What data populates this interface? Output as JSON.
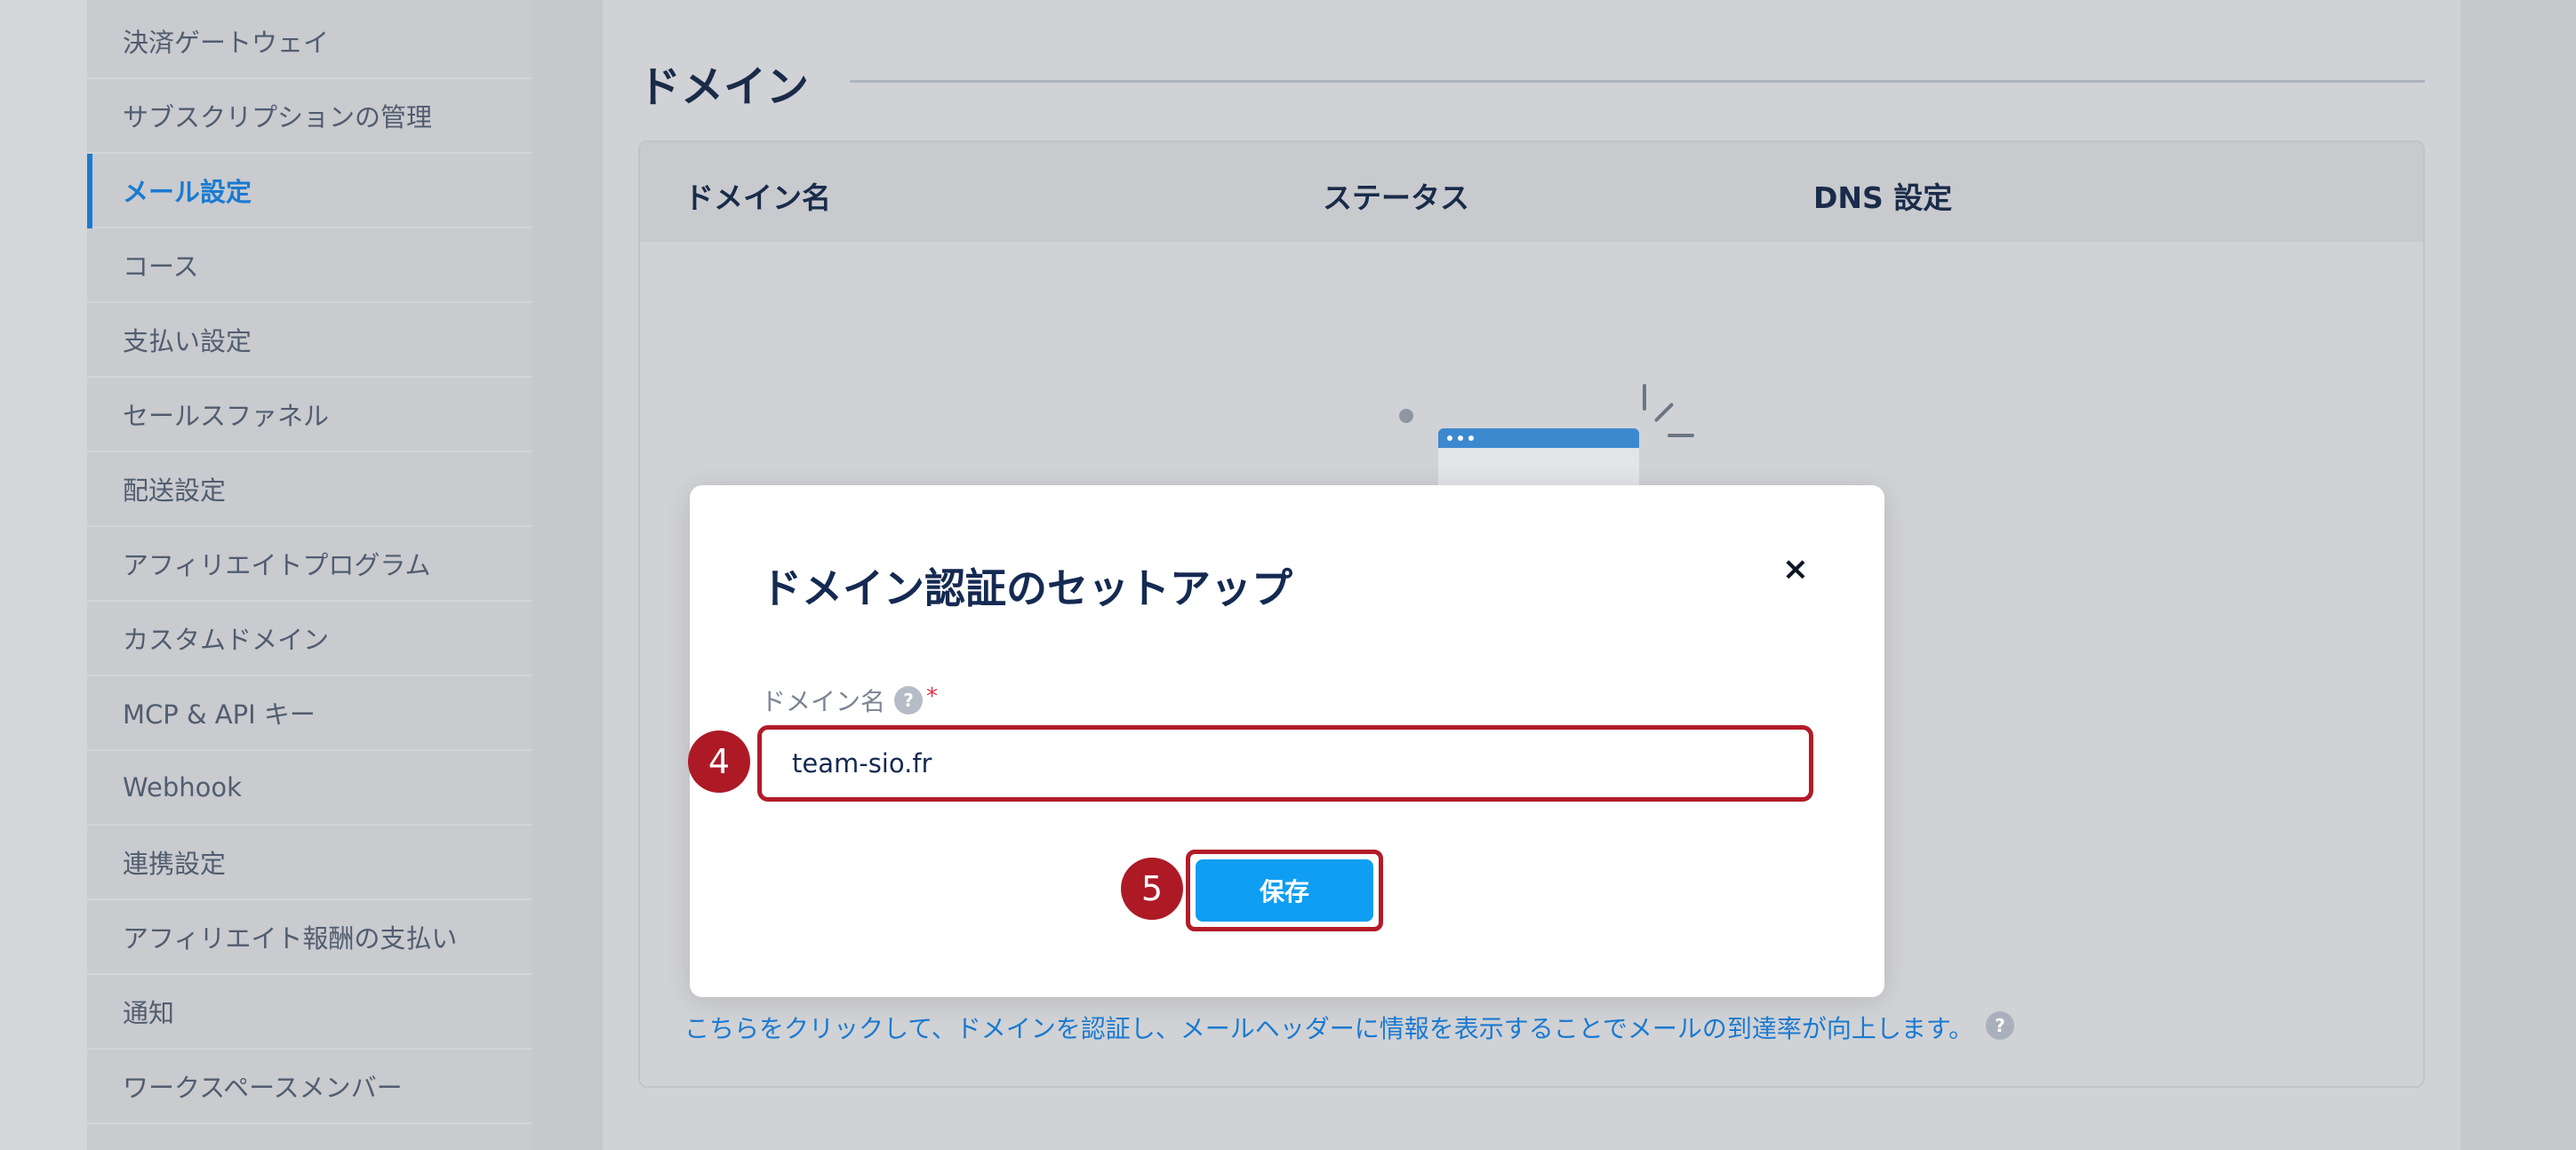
{
  "sidebar": {
    "items": [
      {
        "label": "決済ゲートウェイ",
        "active": false
      },
      {
        "label": "サブスクリプションの管理",
        "active": false
      },
      {
        "label": "メール設定",
        "active": true
      },
      {
        "label": "コース",
        "active": false
      },
      {
        "label": "支払い設定",
        "active": false
      },
      {
        "label": "セールスファネル",
        "active": false
      },
      {
        "label": "配送設定",
        "active": false
      },
      {
        "label": "アフィリエイトプログラム",
        "active": false
      },
      {
        "label": "カスタムドメイン",
        "active": false
      },
      {
        "label": "MCP & API キー",
        "active": false
      },
      {
        "label": "Webhook",
        "active": false
      },
      {
        "label": "連携設定",
        "active": false
      },
      {
        "label": "アフィリエイト報酬の支払い",
        "active": false
      },
      {
        "label": "通知",
        "active": false
      },
      {
        "label": "ワークスペースメンバー",
        "active": false
      }
    ]
  },
  "main": {
    "section_title": "ドメイン",
    "table": {
      "columns": [
        "ドメイン名",
        "ステータス",
        "DNS 設定"
      ]
    },
    "helper_text": "こちらをクリックして、ドメインを認証し、メールヘッダーに情報を表示することでメールの到達率が向上します。",
    "helper_icon": "?"
  },
  "modal": {
    "title": "ドメイン認証のセットアップ",
    "close_icon": "×",
    "field_label": "ドメイン名",
    "field_help_icon": "?",
    "field_required_mark": "*",
    "field_value": "team-sio.fr",
    "save_label": "保存"
  },
  "annotations": {
    "step_input": "4",
    "step_save": "5"
  },
  "colors": {
    "accent": "#1a7ad1",
    "primary_button": "#0f9ef2",
    "annotation_red": "#ad1a25",
    "title_navy": "#142a52"
  }
}
